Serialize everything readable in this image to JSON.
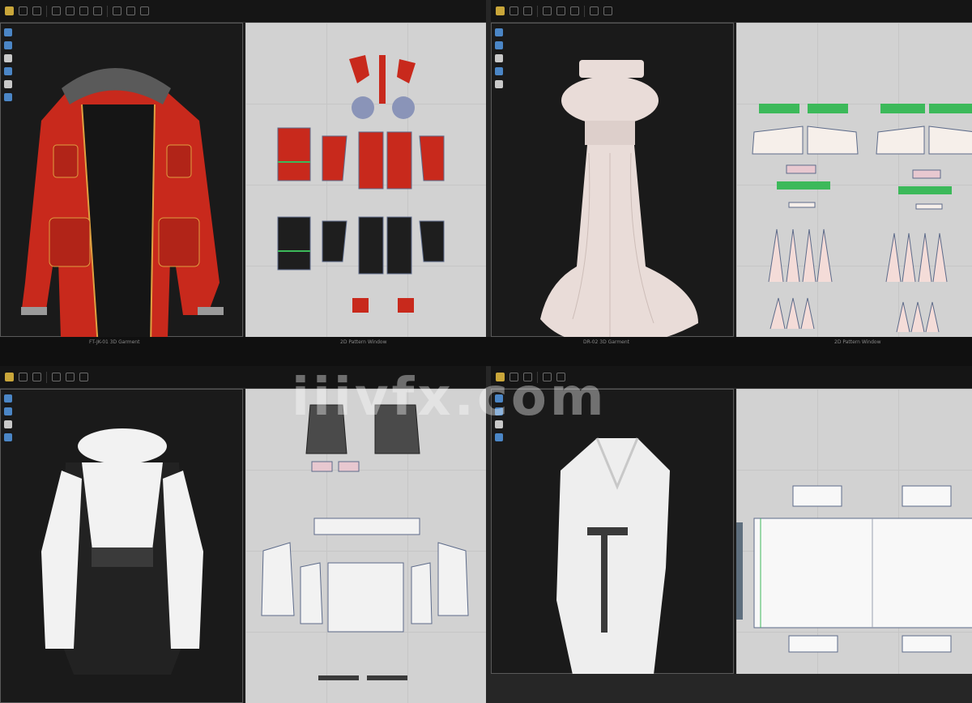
{
  "panels": [
    {
      "id": "jacket",
      "caption": "FT-JK-01 3D Garment"
    },
    {
      "id": "dress",
      "caption": "DR-02 3D Garment"
    },
    {
      "id": "blouse",
      "caption": "2D Pattern Window"
    },
    {
      "id": "robe",
      "caption": "2D Pattern Window"
    }
  ],
  "watermark": "iiivfx.com",
  "colors": {
    "jacket_red": "#c8291c",
    "dress_satin": "#e9dcd8",
    "trim_green": "#3cb95a",
    "pattern_bg": "#d2d2d2",
    "blouse_white": "#f2f2f2"
  }
}
